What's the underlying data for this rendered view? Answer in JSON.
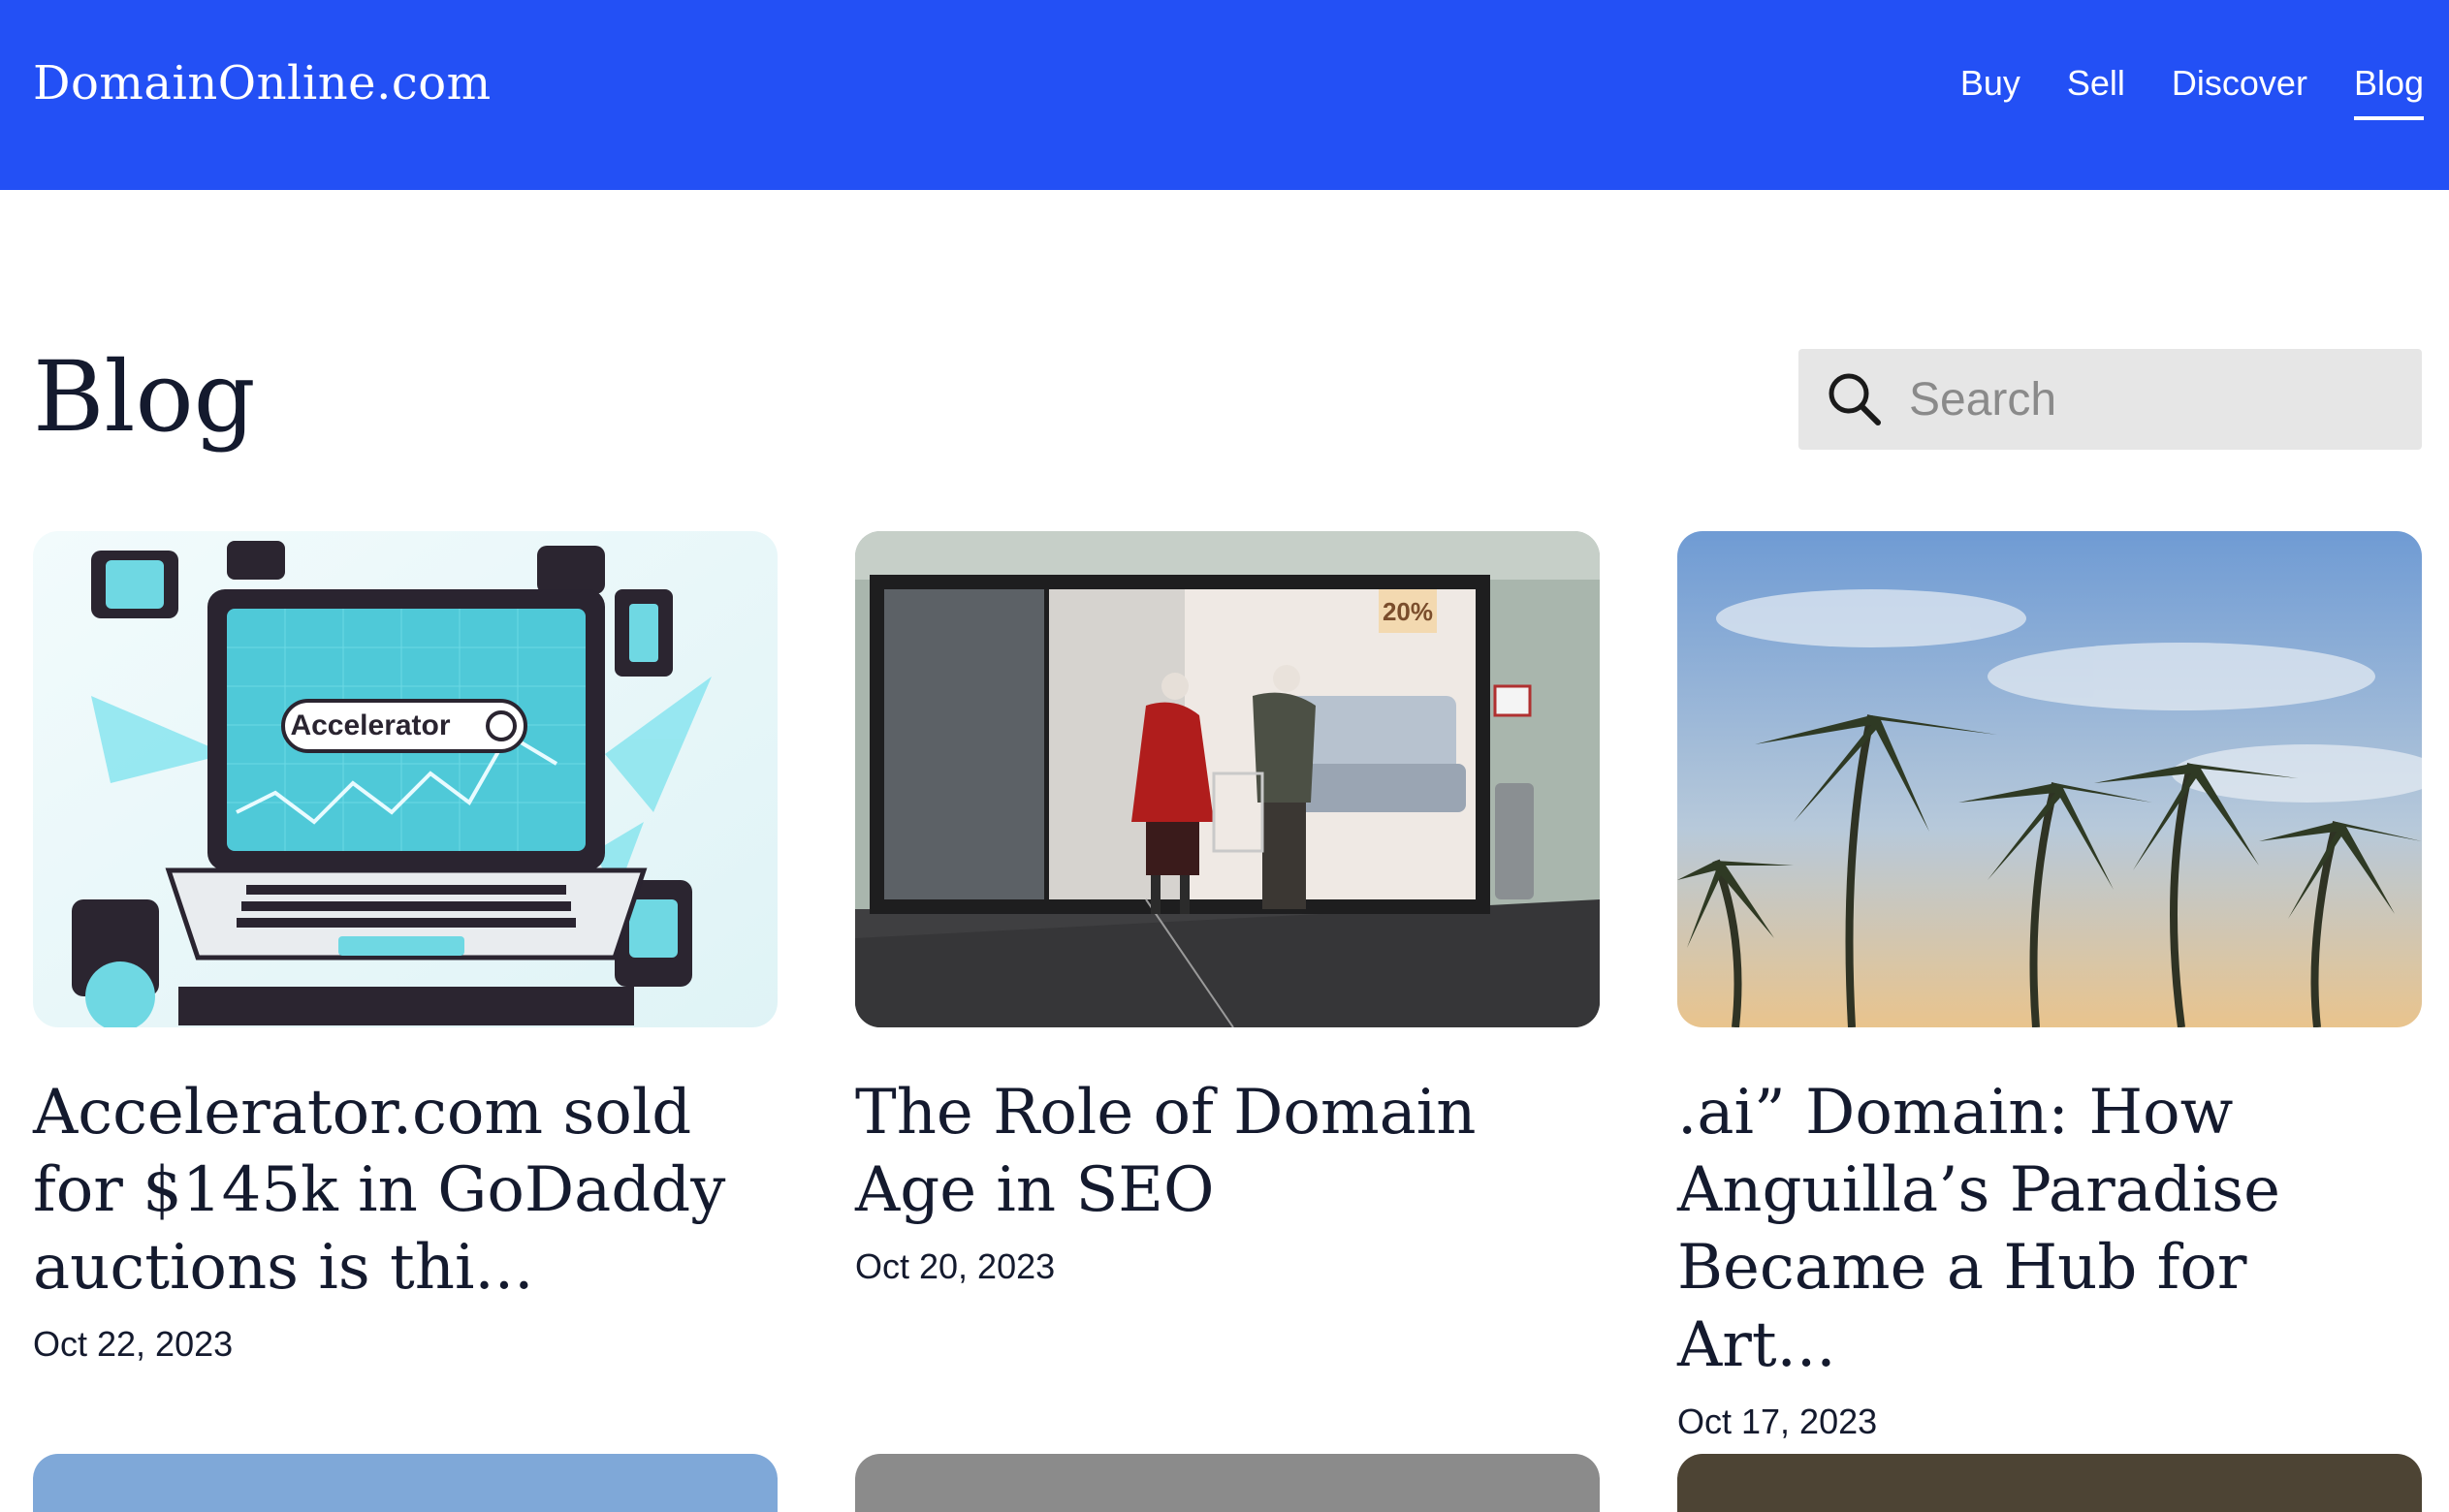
{
  "header": {
    "logo": "DomainOnline.com",
    "nav": [
      {
        "label": "Buy",
        "active": false
      },
      {
        "label": "Sell",
        "active": false
      },
      {
        "label": "Discover",
        "active": false
      },
      {
        "label": "Blog",
        "active": true
      }
    ]
  },
  "page": {
    "title": "Blog"
  },
  "search": {
    "placeholder": "Search",
    "icon": "search-icon"
  },
  "posts": [
    {
      "title": "Accelerator.com sold for $145k in GoDaddy auctions is thi...",
      "date": "Oct 22, 2023",
      "image_text": "Accelerator"
    },
    {
      "title": "The Role of Domain Age in SEO",
      "date": "Oct 20, 2023",
      "image_text": "20%"
    },
    {
      "title": ".ai” Domain: How Anguilla’s Paradise Became a Hub for Art...",
      "date": "Oct 17, 2023"
    }
  ],
  "colors": {
    "header_bg": "#2350f5",
    "text": "#141a2e",
    "search_bg": "#e6e6e6"
  }
}
